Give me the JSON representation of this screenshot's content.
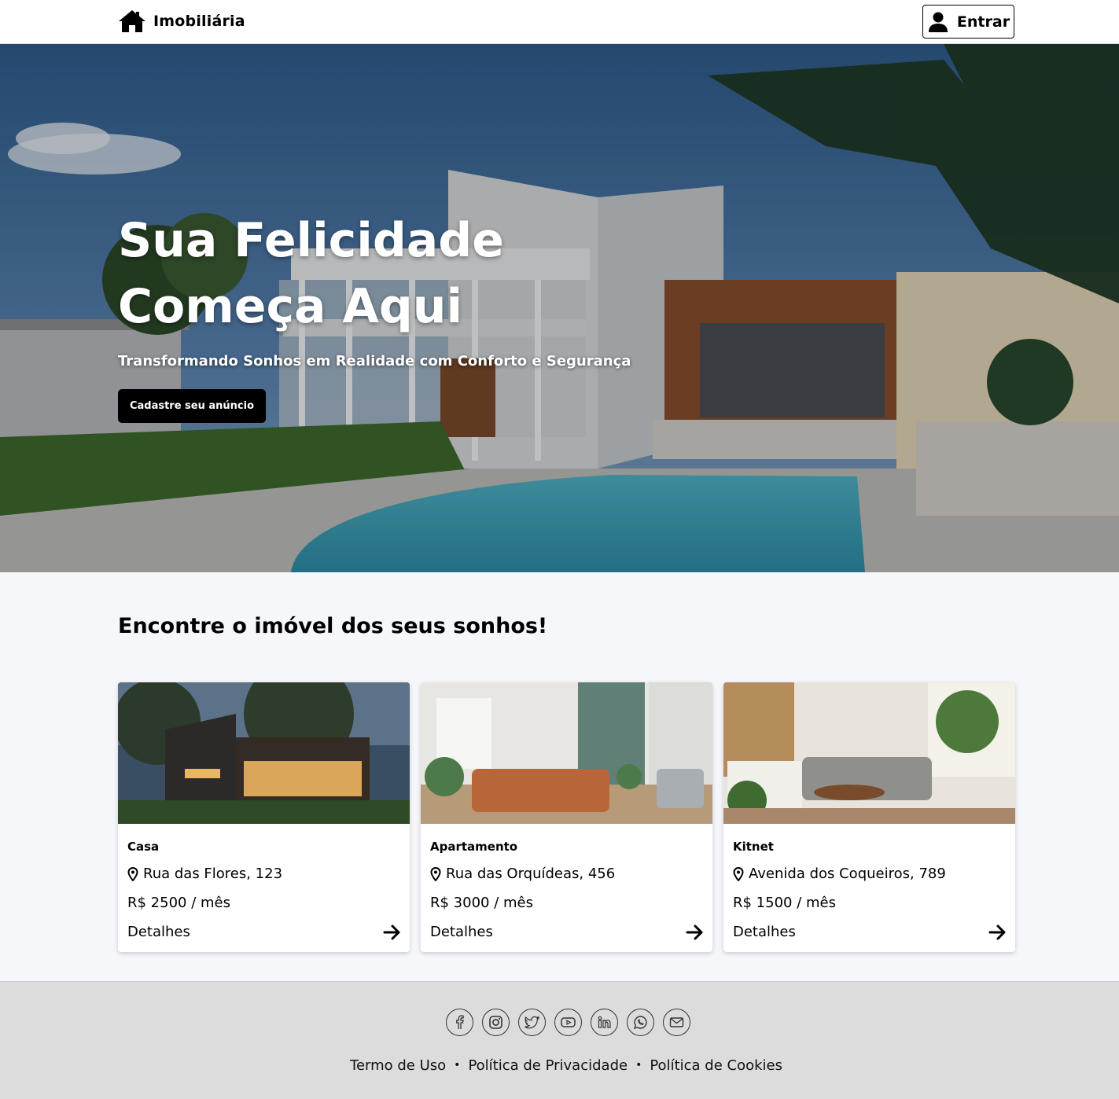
{
  "nav": {
    "brand": "Imobiliária",
    "login_label": "Entrar"
  },
  "hero": {
    "title_line1": "Sua Felicidade",
    "title_line2": "Começa Aqui",
    "subtitle": "Transformando Sonhos em Realidade com Conforto e Segurança",
    "cta_label": "Cadastre seu anúncio"
  },
  "listings": {
    "title": "Encontre o imóvel dos seus sonhos!",
    "cards": [
      {
        "type": "Casa",
        "address": "Rua das Flores, 123",
        "price": "R$ 2500 / mês",
        "details": "Detalhes"
      },
      {
        "type": "Apartamento",
        "address": "Rua das Orquídeas, 456",
        "price": "R$ 3000 / mês",
        "details": "Detalhes"
      },
      {
        "type": "Kitnet",
        "address": "Avenida dos Coqueiros, 789",
        "price": "R$ 1500 / mês",
        "details": "Detalhes"
      }
    ]
  },
  "footer": {
    "socials": [
      "facebook-icon",
      "instagram-icon",
      "twitter-icon",
      "youtube-icon",
      "linkedin-icon",
      "whatsapp-icon",
      "email-icon"
    ],
    "links": [
      "Termo de Uso",
      "Política de Privacidade",
      "Política de Cookies"
    ]
  }
}
